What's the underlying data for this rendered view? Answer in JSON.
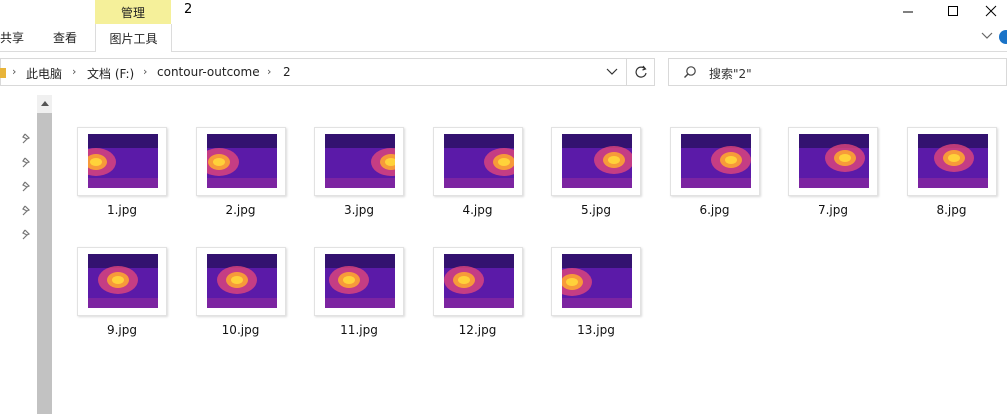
{
  "window": {
    "title": "2",
    "manage_label": "管理"
  },
  "ribbon": {
    "tabs": [
      "共享",
      "查看",
      "图片工具"
    ]
  },
  "address": {
    "crumbs": [
      "此电脑",
      "文档 (F:)",
      "contour-outcome",
      "2"
    ]
  },
  "search": {
    "placeholder": "搜索\"2\""
  },
  "files": [
    "1.jpg",
    "2.jpg",
    "3.jpg",
    "4.jpg",
    "5.jpg",
    "6.jpg",
    "7.jpg",
    "8.jpg",
    "9.jpg",
    "10.jpg",
    "11.jpg",
    "12.jpg",
    "13.jpg"
  ],
  "colors": {
    "thumb_bg": "#5b1aa8",
    "thumb_dark": "#26105e",
    "hot": "#ffd23a",
    "mid": "#e0467a",
    "accent": "#1a73c7"
  },
  "icons": [
    "minimize-icon",
    "maximize-icon",
    "close-icon",
    "chevron-down-icon",
    "help-icon",
    "refresh-icon",
    "search-icon",
    "pin-icon",
    "scroll-up-icon"
  ]
}
